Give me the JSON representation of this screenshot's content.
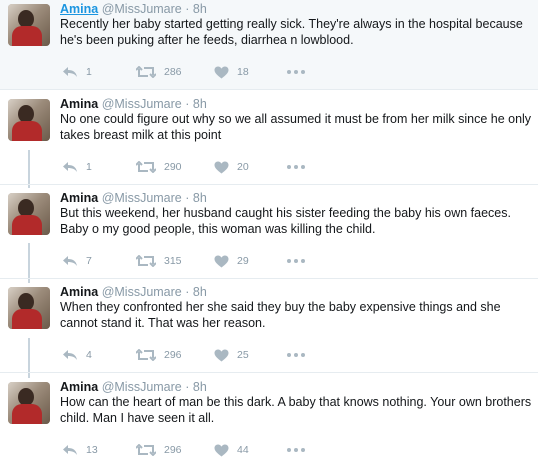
{
  "tweets": [
    {
      "name": "Amina",
      "handle": "@MissJumare",
      "dot": "·",
      "time": "8h",
      "text": "Recently her baby started getting really sick. They're always in the hospital because he's been puking after he feeds, diarrhea n lowblood.",
      "replies": "1",
      "retweets": "286",
      "likes": "18"
    },
    {
      "name": "Amina",
      "handle": "@MissJumare",
      "dot": "·",
      "time": "8h",
      "text": "No one could figure out why so we all assumed it must be from her milk since he only takes breast milk at this point",
      "replies": "1",
      "retweets": "290",
      "likes": "20"
    },
    {
      "name": "Amina",
      "handle": "@MissJumare",
      "dot": "·",
      "time": "8h",
      "text": "But this weekend, her husband caught his sister feeding the baby his own faeces. Baby o my good people, this woman was killing the child.",
      "replies": "7",
      "retweets": "315",
      "likes": "29"
    },
    {
      "name": "Amina",
      "handle": "@MissJumare",
      "dot": "·",
      "time": "8h",
      "text": "When they confronted her she said they buy the baby expensive things and she cannot stand it. That was her reason.",
      "replies": "4",
      "retweets": "296",
      "likes": "25"
    },
    {
      "name": "Amina",
      "handle": "@MissJumare",
      "dot": "·",
      "time": "8h",
      "text": "How can the heart of man be this dark. A baby that knows nothing. Your own brothers child. Man I have seen it all.",
      "replies": "13",
      "retweets": "296",
      "likes": "44"
    }
  ],
  "icons": {
    "reply": "reply-icon",
    "retweet": "retweet-icon",
    "like": "heart-icon",
    "more": "more-icon"
  },
  "colors": {
    "accent": "#1b95e0",
    "muted": "#8899a6",
    "thread_line": "#c8d4dd"
  }
}
